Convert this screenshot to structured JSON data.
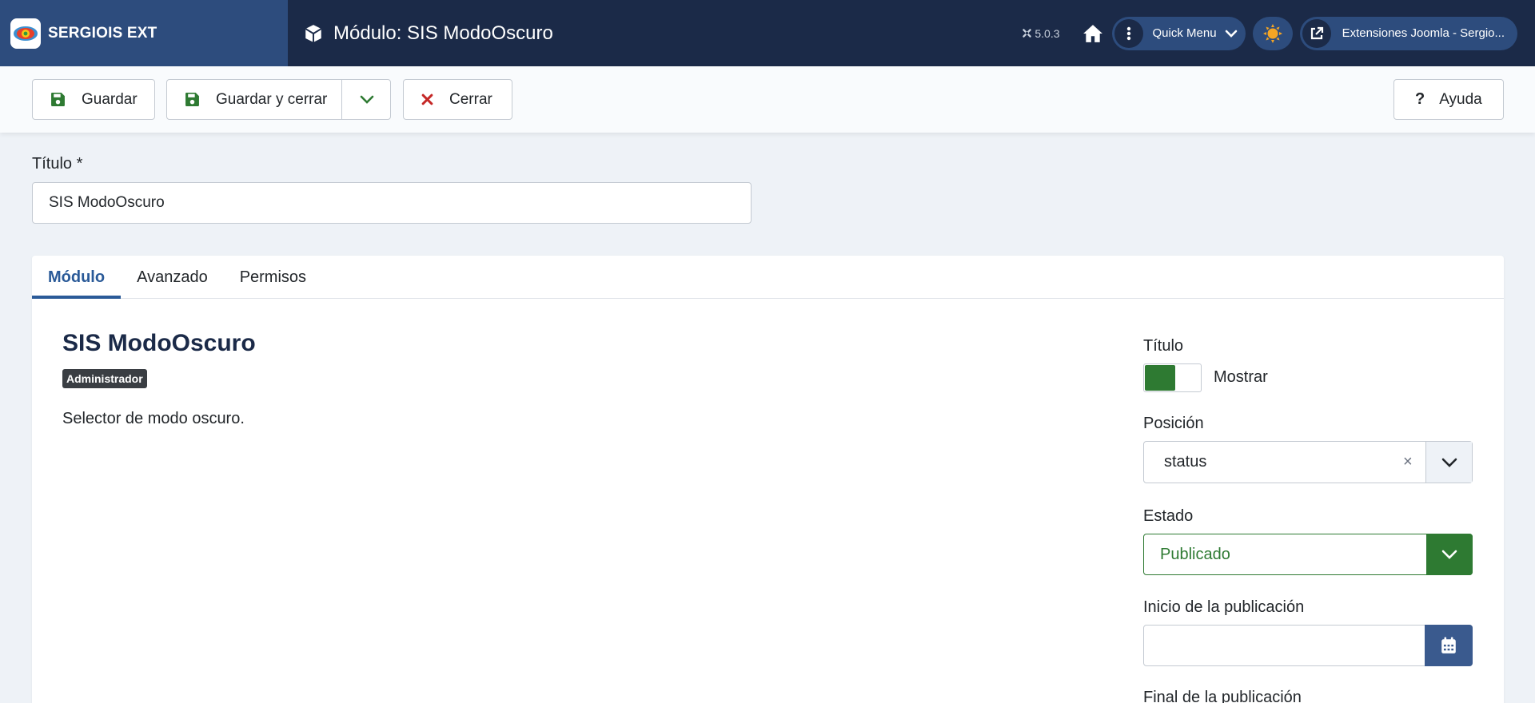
{
  "header": {
    "brand": "SERGIOIS EXT",
    "title": "Módulo: SIS ModoOscuro",
    "version": "5.0.3",
    "quick_menu": "Quick Menu",
    "site_link": "Extensiones Joomla - Sergio..."
  },
  "toolbar": {
    "save": "Guardar",
    "save_close": "Guardar y cerrar",
    "close": "Cerrar",
    "help": "Ayuda"
  },
  "title_field": {
    "label": "Título *",
    "value": "SIS ModoOscuro"
  },
  "tabs": [
    "Módulo",
    "Avanzado",
    "Permisos"
  ],
  "module": {
    "name": "SIS ModoOscuro",
    "badge": "Administrador",
    "description": "Selector de modo oscuro."
  },
  "options": {
    "show_title_label": "Título",
    "show_title_value": "Mostrar",
    "position_label": "Posición",
    "position_value": "status",
    "position_clear": "×",
    "status_label": "Estado",
    "status_value": "Publicado",
    "publish_up_label": "Inicio de la publicación",
    "publish_up_value": "",
    "publish_down_label": "Final de la publicación"
  },
  "colors": {
    "header_bg": "#1b2a48",
    "brand_bg": "#2d4c7d",
    "success": "#2e7a32",
    "danger": "#c52827",
    "link": "#2a5a98"
  }
}
